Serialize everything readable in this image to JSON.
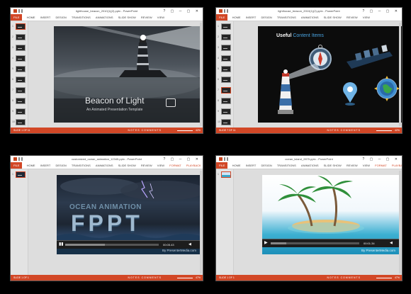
{
  "windows": [
    {
      "title": "lighthouse_beacon_2010(1)(2).pptx - PowerPoint",
      "tabs": [
        "HOME",
        "INSERT",
        "DESIGN",
        "TRANSITIONS",
        "ANIMATIONS",
        "SLIDE SHOW",
        "REVIEW",
        "VIEW"
      ],
      "file_label": "FILE",
      "status_left": "SLIDE 1 OF 11",
      "status_mid": "NOTES  COMMENTS",
      "zoom": "42%",
      "slide": {
        "title": "Beacon of Light",
        "subtitle": "An Animated Presentation Template"
      }
    },
    {
      "title": "lighthouse_beacon_2010(1)(2).pptx - PowerPoint",
      "tabs": [
        "HOME",
        "INSERT",
        "DESIGN",
        "TRANSITIONS",
        "ANIMATIONS",
        "SLIDE SHOW",
        "REVIEW",
        "VIEW"
      ],
      "file_label": "FILE",
      "status_left": "SLIDE 7 OF 11",
      "status_mid": "NOTES  COMMENTS",
      "zoom": "42%",
      "slide": {
        "title_a": "Useful",
        "title_b": "Content Items"
      }
    },
    {
      "title": "customized_ocean_animation_12345.pptx - PowerPoint",
      "tabs": [
        "HOME",
        "INSERT",
        "DESIGN",
        "TRANSITIONS",
        "ANIMATIONS",
        "SLIDE SHOW",
        "REVIEW",
        "VIEW",
        "FORMAT",
        "PLAYBACK"
      ],
      "file_label": "FILE",
      "status_left": "SLIDE 1 OF 1",
      "status_mid": "NOTES  COMMENTS",
      "zoom": "47%",
      "slide": {
        "headline": "OCEAN ANIMATION",
        "big": "FPPT",
        "credit": "By PresenterMedia.com"
      },
      "player": {
        "time": "00:05.43"
      }
    },
    {
      "title": "ocean_island_2875.pptx - PowerPoint",
      "tabs": [
        "HOME",
        "INSERT",
        "DESIGN",
        "TRANSITIONS",
        "ANIMATIONS",
        "SLIDE SHOW",
        "REVIEW",
        "VIEW",
        "FORMAT",
        "PLAYBACK"
      ],
      "file_label": "FILE",
      "status_left": "SLIDE 1 OF 1",
      "status_mid": "NOTES  COMMENTS",
      "zoom": "47%",
      "slide": {
        "credit": "By PresenterMedia.com"
      },
      "player": {
        "time": "00:01.34"
      }
    }
  ]
}
